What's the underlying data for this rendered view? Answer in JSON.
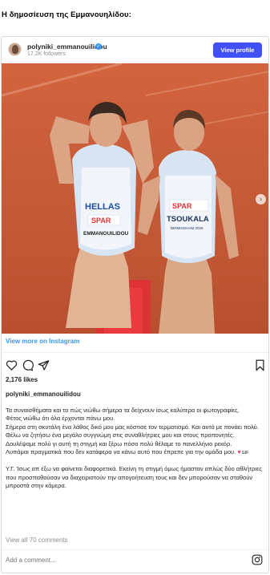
{
  "heading": "Η δημοσίευση της Εμμανουηλίδου:",
  "post": {
    "username": "polyniki_emmanouilidou",
    "followers": "17.2K followers",
    "view_profile_label": "View profile",
    "view_more_label": "View more on Instagram",
    "likes": "2,176 likes",
    "caption_username": "polyniki_emmanouilidou",
    "caption_lines": [
      "Τα συναισθήματα και το πώς νιώθω σήμερα τα δείχνουν ίσως καλύτερα οι φωτογραφίες.",
      "Φέτος νιώθω ότι όλα έρχονται πάνω μου.",
      "Σήμερα στη σκυτάλη ένα λάθος δικό μου μας κόστισε τον τερματισμό. Και αυτό με πονάει πολύ.",
      "Θέλω να ζητήσω ένα μεγάλο συγγνώμη στις συναθλήτριες μου και στους προπονητές. Δουλέψαμε πολύ γι αυτή τη στιγμή και ξέρω πόσο πολύ θέλαμε το πανελλήνιο ρεκόρ.",
      "Λυπάμαι πραγματικά που δεν κατάφερα να κάνω αυτό που έπρεπε για την ομάδα μου."
    ],
    "gif_label": "GIF",
    "ps": "Υ.Γ. Ίσως απ έξω να φαίνεται διαφορετικά. Εκείνη τη στιγμή όμως ήμασταν απλώς δύο αθλήτριες που προσπαθούσαν να διαχειριστούν την απογοήτευση τους και δεν μπορούσαν να σταθούν μπροστά στην κάμερα.",
    "view_all_comments": "View all 70 comments",
    "comment_placeholder": "Add a comment..."
  },
  "photo": {
    "bib_left_team": "HELLAS",
    "bib_left_sponsor": "SPAR",
    "bib_left_name": "EMMANOUILIDOU",
    "bib_right_sponsor": "SPAR",
    "bib_right_name": "TSOUKALA",
    "bib_right_city": "BIRMINGHAM 2026"
  },
  "icons": [
    "verified-icon",
    "heart-icon",
    "comment-icon",
    "share-icon",
    "bookmark-icon",
    "chevron-right-icon",
    "instagram-icon"
  ],
  "colors": {
    "accent": "#4150f7",
    "link": "#3897f0",
    "track": "#c85a38",
    "text": "#262626",
    "muted": "#8e8e8e"
  },
  "carousel": {
    "total": 3,
    "active": 1
  }
}
